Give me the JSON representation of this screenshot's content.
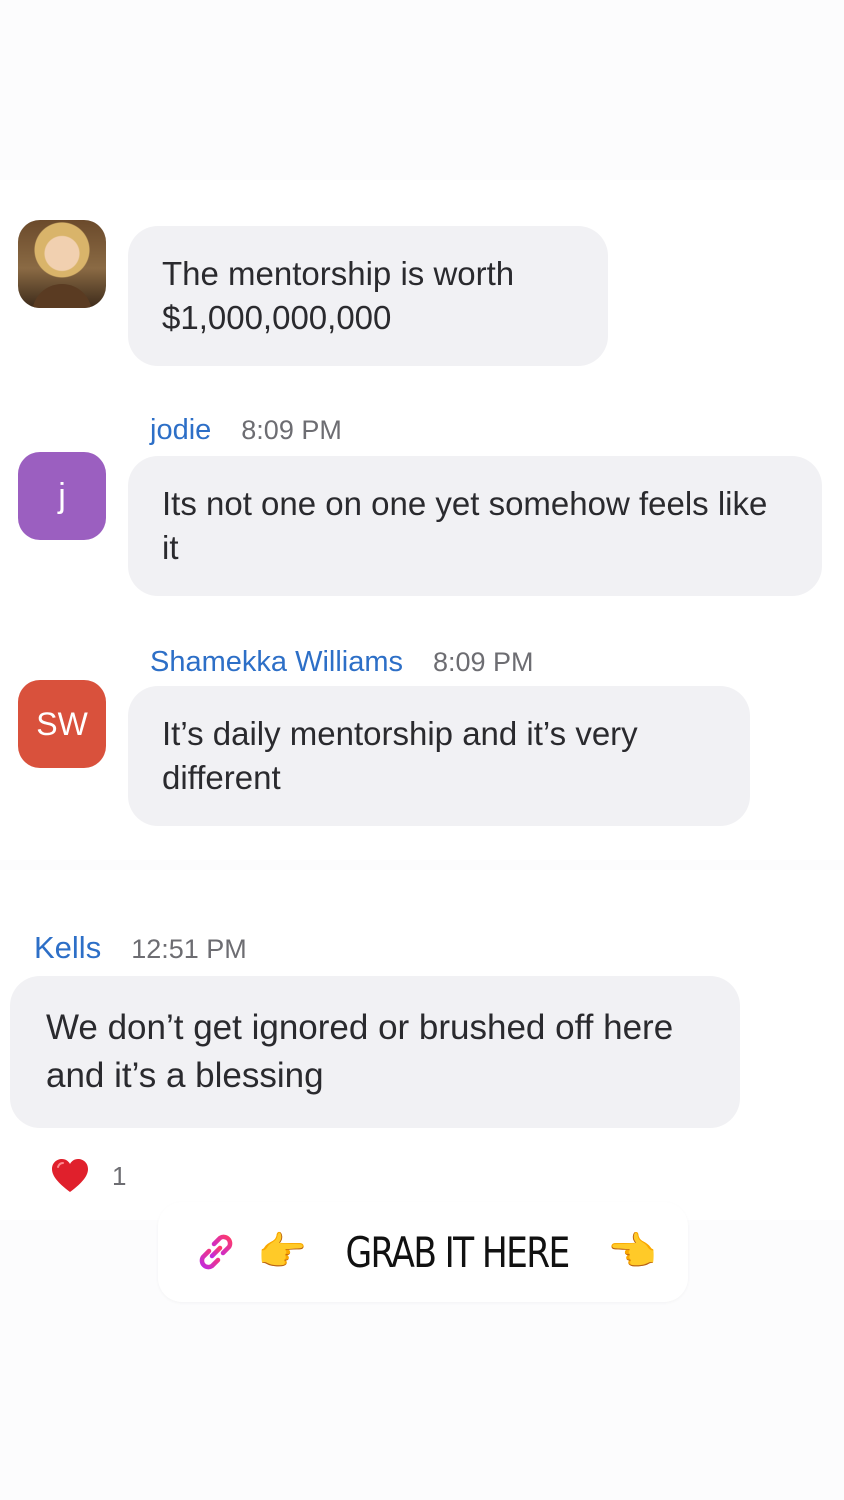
{
  "messages": [
    {
      "sender": "",
      "time": "",
      "avatar": "photo",
      "text": "The mentorship is worth $1,000,000,000"
    },
    {
      "sender": "jodie",
      "time": "8:09 PM",
      "avatar_initials": "j",
      "avatar_color": "#9b5fc0",
      "text": "Its not one on one yet somehow feels like it"
    },
    {
      "sender": "Shamekka Williams",
      "time": "8:09 PM",
      "avatar_initials": "SW",
      "avatar_color": "#d9513c",
      "text": "It’s daily mentorship and it’s very different"
    },
    {
      "sender": "Kells",
      "time": "12:51 PM",
      "text": "We don’t get ignored or brushed off here and it’s a blessing",
      "reaction": {
        "icon": "heart-icon",
        "count": "1"
      }
    }
  ],
  "cta": {
    "link_icon": "link-icon",
    "left_emoji": "👉",
    "label": "GRAB IT HERE",
    "right_emoji": "👈"
  },
  "colors": {
    "sender_name": "#2d6fc7",
    "bubble_bg": "#f1f1f4",
    "heart": "#e0202c"
  }
}
